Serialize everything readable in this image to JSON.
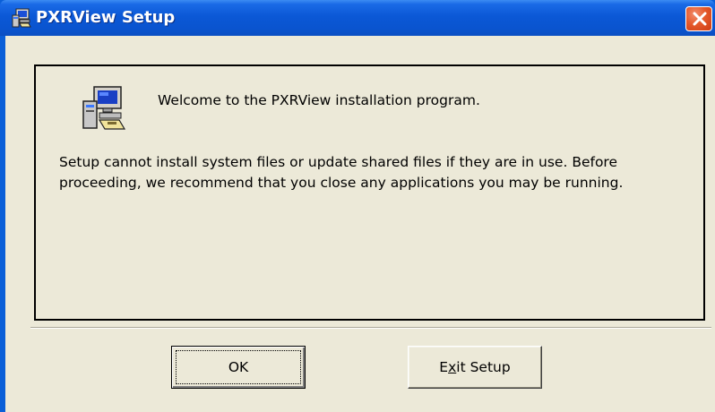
{
  "window": {
    "title": "PXRView Setup",
    "close_icon": "close-icon"
  },
  "message": {
    "icon": "setup-computer-icon",
    "welcome": "Welcome to the PXRView installation program.",
    "body": "Setup cannot install system files or update shared files if they are in use. Before proceeding, we recommend that you close any applications you may be running."
  },
  "buttons": {
    "ok_label": "OK",
    "exit_label_before": "E",
    "exit_label_accel": "x",
    "exit_label_after": "it Setup"
  },
  "colors": {
    "titlebar": "#0a54cf",
    "dialog_background": "#ece9d8",
    "close_button": "#e55a2c"
  }
}
